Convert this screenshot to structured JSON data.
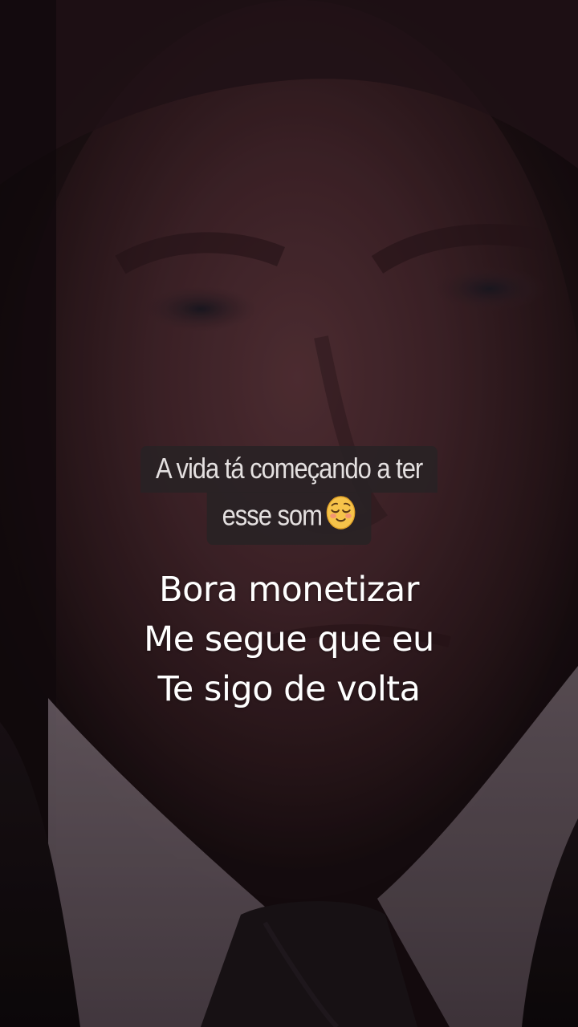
{
  "caption": {
    "line1": "A vida tá começando a ter",
    "line2": "esse som",
    "emoji": "relieved-face-icon"
  },
  "overlay": {
    "lines": [
      "Bora monetizar",
      "Me segue que eu",
      "Te sigo de volta"
    ]
  },
  "colors": {
    "caption_bg": "#282224",
    "caption_text": "#e4e0e0",
    "overlay_text": "#ffffff",
    "background_tint": "#3a2026"
  }
}
